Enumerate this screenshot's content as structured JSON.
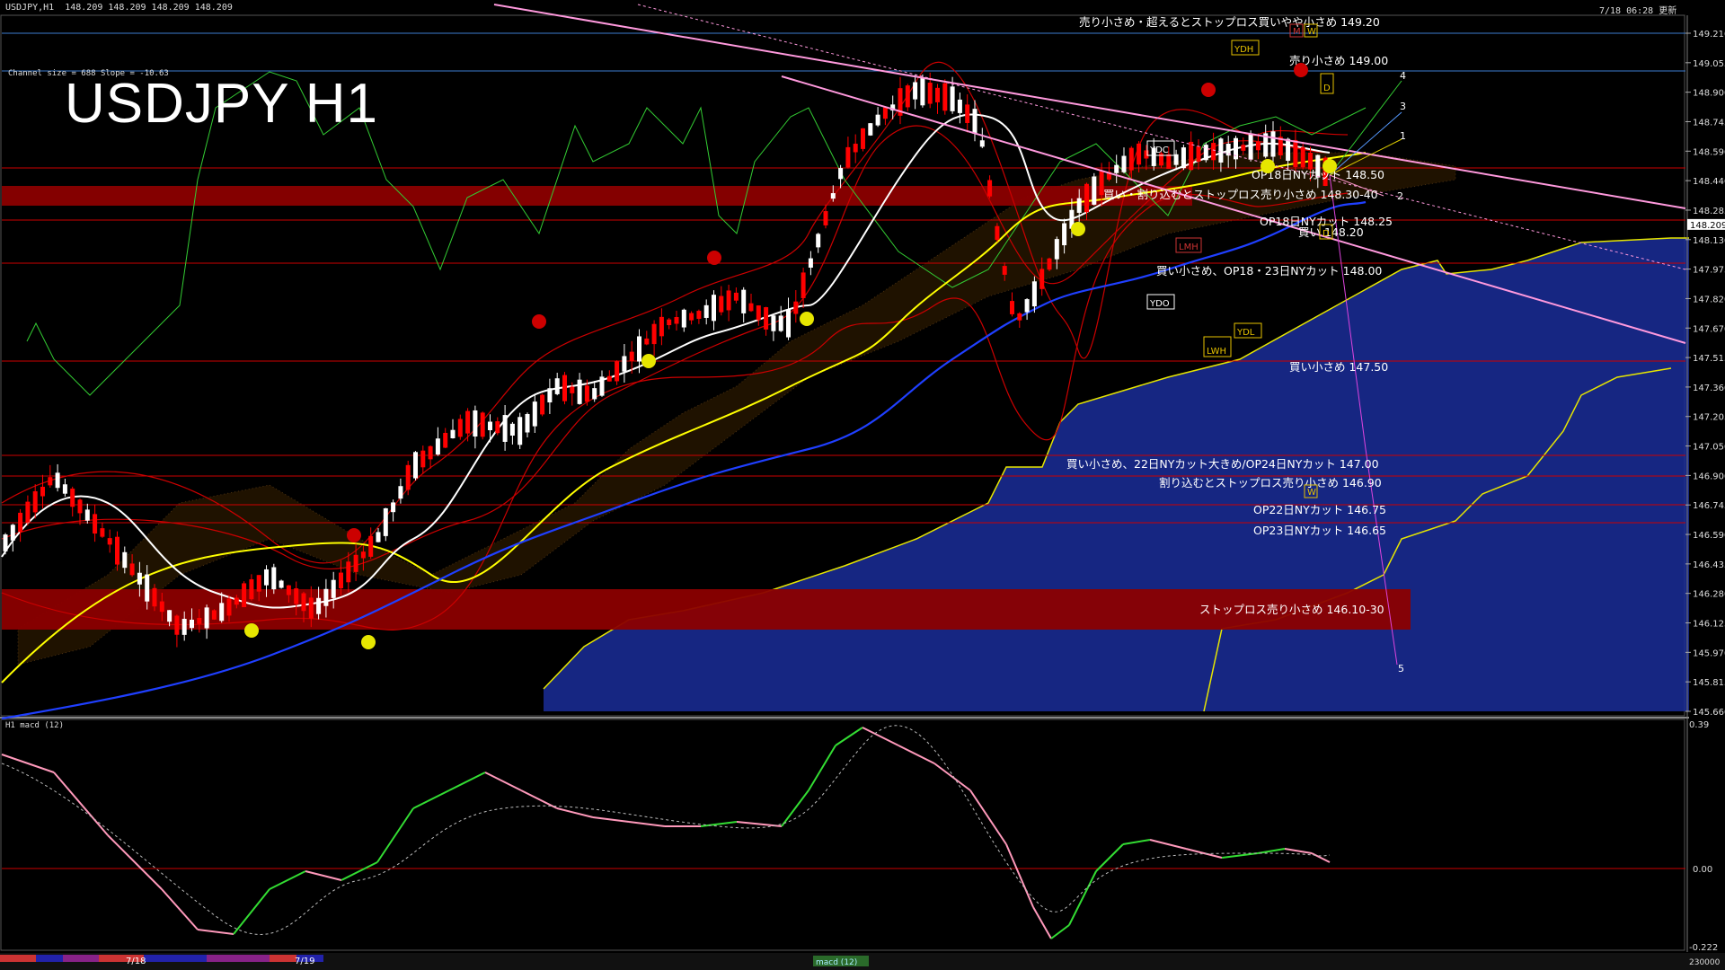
{
  "header": {
    "symbol_info": "USDJPY,H1  148.209 148.209 148.209 148.209",
    "timestamp": "7/18 06:28 更新"
  },
  "title": "USDJPY H1",
  "channel_info": "Channel size = 688 Slope = -10.63",
  "price_axis": {
    "labels": [
      "149.210",
      "149.055",
      "148.900",
      "148.745",
      "148.590",
      "148.440",
      "148.285",
      "148.130",
      "147.975",
      "147.820",
      "147.670",
      "147.515",
      "147.360",
      "147.205",
      "147.050",
      "146.900",
      "146.745",
      "146.590",
      "146.435",
      "146.280",
      "146.125",
      "145.970",
      "145.815",
      "145.660"
    ],
    "current_price": "148.209"
  },
  "macd": {
    "label": "H1 macd (12)",
    "axis_labels": [
      "0.39",
      "0.00",
      "-0.222"
    ]
  },
  "bottom_bar": {
    "dates": [
      "7/18",
      "7/19"
    ],
    "footer_value": "230000",
    "indicator_tag": "macd (12)"
  },
  "level_notes": [
    {
      "text": "売り小さめ・超えるとストップロス買いやや小さめ 149.20"
    },
    {
      "text": "売り小さめ 149.00"
    },
    {
      "text": "OP18日NYカット 148.50"
    },
    {
      "text": "買い・割り込むとストップロス売り小さめ 148.30-40"
    },
    {
      "text": "OP18日NYカット 148.25"
    },
    {
      "text": "買い 148.20"
    },
    {
      "text": "買い小さめ、OP18・23日NYカット 148.00"
    },
    {
      "text": "買い小さめ 147.50"
    },
    {
      "text": "買い小さめ、22日NYカット大きめ/OP24日NYカット 147.00"
    },
    {
      "text": "割り込むとストップロス売り小さめ 146.90"
    },
    {
      "text": "OP22日NYカット 146.75"
    },
    {
      "text": "OP23日NYカット 146.65"
    },
    {
      "text": "ストップロス売り小さめ 146.10-30"
    }
  ],
  "markers": {
    "ydh": "YDH",
    "ydc": "YDC",
    "ydo": "YDO",
    "ydl": "YDL",
    "lwh": "LWH",
    "lmh": "LMH",
    "m": "M",
    "w": "W",
    "d": "D",
    "waves": [
      "1",
      "2",
      "3",
      "4",
      "5"
    ]
  },
  "colors": {
    "background": "#000000",
    "bull": "#ffffff",
    "bear": "#ff0000",
    "zone": "#8b0000",
    "channel": "#ff99dd",
    "sma_white": "#ffffff",
    "sma_yellow": "#ffff00",
    "sma_blue": "#1f3fff",
    "macd_up": "#33dd33",
    "macd_down": "#ff99bb",
    "kumo": "#1a2d99"
  }
}
